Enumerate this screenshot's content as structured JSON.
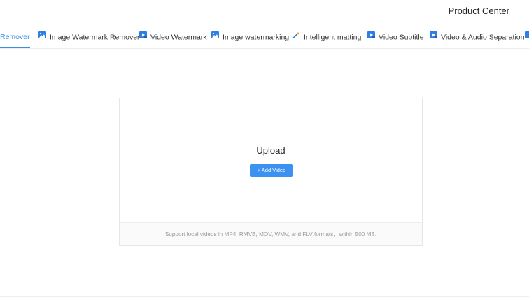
{
  "header": {
    "product_center": "Product Center"
  },
  "tabs": [
    {
      "label": "Remover",
      "icon": "none",
      "active": true
    },
    {
      "label": "Image Watermark Remover",
      "icon": "image-icon"
    },
    {
      "label": "Video Watermark",
      "icon": "video-icon"
    },
    {
      "label": "Image watermarking",
      "icon": "image-icon"
    },
    {
      "label": "Intelligent matting",
      "icon": "magic-wand-icon"
    },
    {
      "label": "Video Subtitle",
      "icon": "video-icon"
    },
    {
      "label": "Video & Audio Separation",
      "icon": "video-icon"
    }
  ],
  "upload": {
    "title": "Upload",
    "button_label": "+ Add Video",
    "support_text": "Support local videos in MP4, RMVB, MOV, WMV, and FLV formats，within 500 MB."
  },
  "colors": {
    "accent": "#3b8de6",
    "button": "#3b92f0",
    "icon_blue": "#2f7fe0"
  }
}
